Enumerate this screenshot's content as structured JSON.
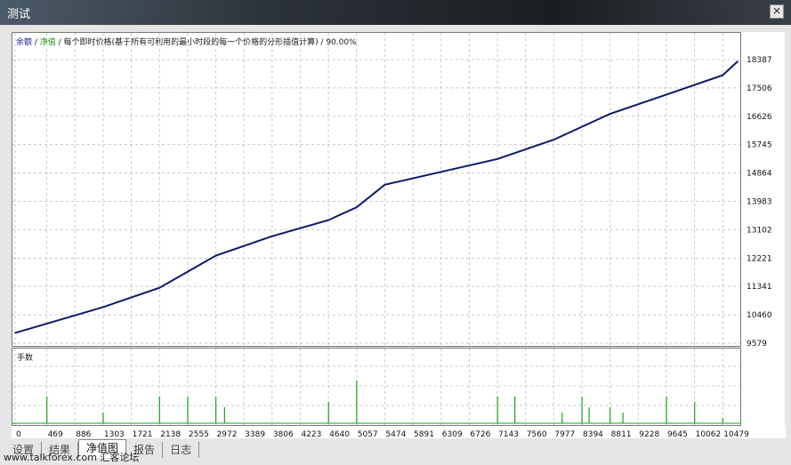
{
  "window": {
    "title": "测试",
    "close_symbol": "×"
  },
  "legend": {
    "balance": "余额",
    "sep1": " / ",
    "equity": "净值",
    "rest": " / 每个即时价格(基于所有可利用的最小时段的每一个价格的分形插值计算) / 90.00%"
  },
  "sub_chart": {
    "label": "手数"
  },
  "y_ticks": [
    "18387",
    "17506",
    "16626",
    "15745",
    "14864",
    "13983",
    "13102",
    "12221",
    "11341",
    "10460",
    "9579"
  ],
  "x_ticks": [
    "0",
    "469",
    "886",
    "1303",
    "1721",
    "2138",
    "2555",
    "2972",
    "3389",
    "3806",
    "4223",
    "4640",
    "5057",
    "5474",
    "5891",
    "6309",
    "6726",
    "7143",
    "7560",
    "7977",
    "8394",
    "8811",
    "9228",
    "9645",
    "10062",
    "10479"
  ],
  "tabs": [
    "设置",
    "结果",
    "净值图",
    "报告",
    "日志"
  ],
  "active_tab": "净值图",
  "watermark": "www.talkforex.com 汇客论坛",
  "colors": {
    "balance_line": "#0a1a6a",
    "lots_bars": "#1ea01e",
    "grid": "#c8c8c8"
  },
  "chart_data": [
    {
      "type": "line",
      "title": "",
      "series": [
        {
          "name": "余额",
          "x": [
            0,
            1303,
            2138,
            2555,
            2972,
            3806,
            4640,
            5057,
            5474,
            6309,
            7143,
            7977,
            8811,
            9645,
            10479,
            10700
          ],
          "values": [
            9900,
            10700,
            11300,
            11800,
            12300,
            12900,
            13400,
            13800,
            14500,
            14900,
            15300,
            15900,
            16700,
            17300,
            17900,
            18330
          ]
        }
      ],
      "ylim": [
        9579,
        18387
      ],
      "xlim": [
        0,
        10700
      ],
      "grid": true,
      "legend": "top-left"
    },
    {
      "type": "bar",
      "series": [
        {
          "name": "手数",
          "x": [
            469,
            1303,
            2138,
            2555,
            2972,
            3100,
            4640,
            5057,
            7143,
            7400,
            8100,
            8394,
            8500,
            8811,
            9000,
            9645,
            10062,
            10479
          ],
          "values": [
            0.5,
            0.2,
            0.5,
            0.5,
            0.5,
            0.3,
            0.4,
            0.8,
            0.5,
            0.5,
            0.2,
            0.5,
            0.3,
            0.3,
            0.2,
            0.5,
            0.4,
            0.1
          ]
        }
      ],
      "grid": true
    }
  ]
}
